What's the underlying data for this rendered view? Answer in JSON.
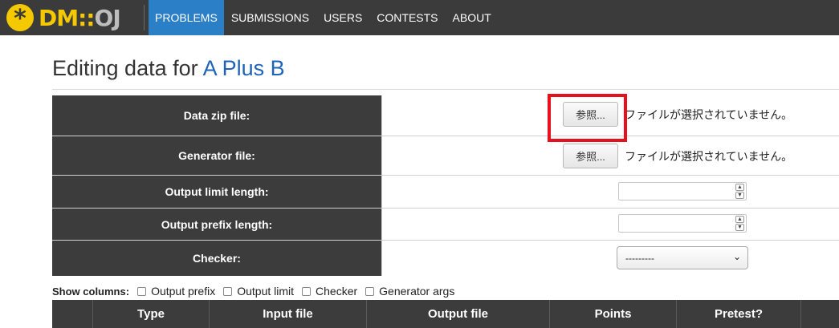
{
  "nav": {
    "logo": {
      "dm": "DM",
      "colons": "::",
      "oj": "OJ"
    },
    "items": [
      {
        "label": "PROBLEMS",
        "active": true
      },
      {
        "label": "SUBMISSIONS",
        "active": false
      },
      {
        "label": "USERS",
        "active": false
      },
      {
        "label": "CONTESTS",
        "active": false
      },
      {
        "label": "ABOUT",
        "active": false
      }
    ]
  },
  "page": {
    "title_prefix": "Editing data for",
    "problem_name": "A Plus B"
  },
  "form": {
    "data_zip": {
      "label": "Data zip file:",
      "button": "参照...",
      "status": "ファイルが選択されていません。"
    },
    "generator": {
      "label": "Generator file:",
      "button": "参照...",
      "status": "ファイルが選択されていません。"
    },
    "output_limit": {
      "label": "Output limit length:",
      "value": ""
    },
    "output_prefix": {
      "label": "Output prefix length:",
      "value": ""
    },
    "checker": {
      "label": "Checker:",
      "selected": "---------"
    }
  },
  "show_columns": {
    "label": "Show columns:",
    "options": [
      "Output prefix",
      "Output limit",
      "Checker",
      "Generator args"
    ]
  },
  "data_table": {
    "headers": [
      "",
      "Type",
      "Input file",
      "Output file",
      "Points",
      "Pretest?",
      ""
    ]
  },
  "colors": {
    "nav_bg": "#3b3b3b",
    "active_tab": "#2b7fc7",
    "logo_yellow": "#f4c900",
    "link_blue": "#1e63b8",
    "highlight_red": "#e8101c"
  }
}
